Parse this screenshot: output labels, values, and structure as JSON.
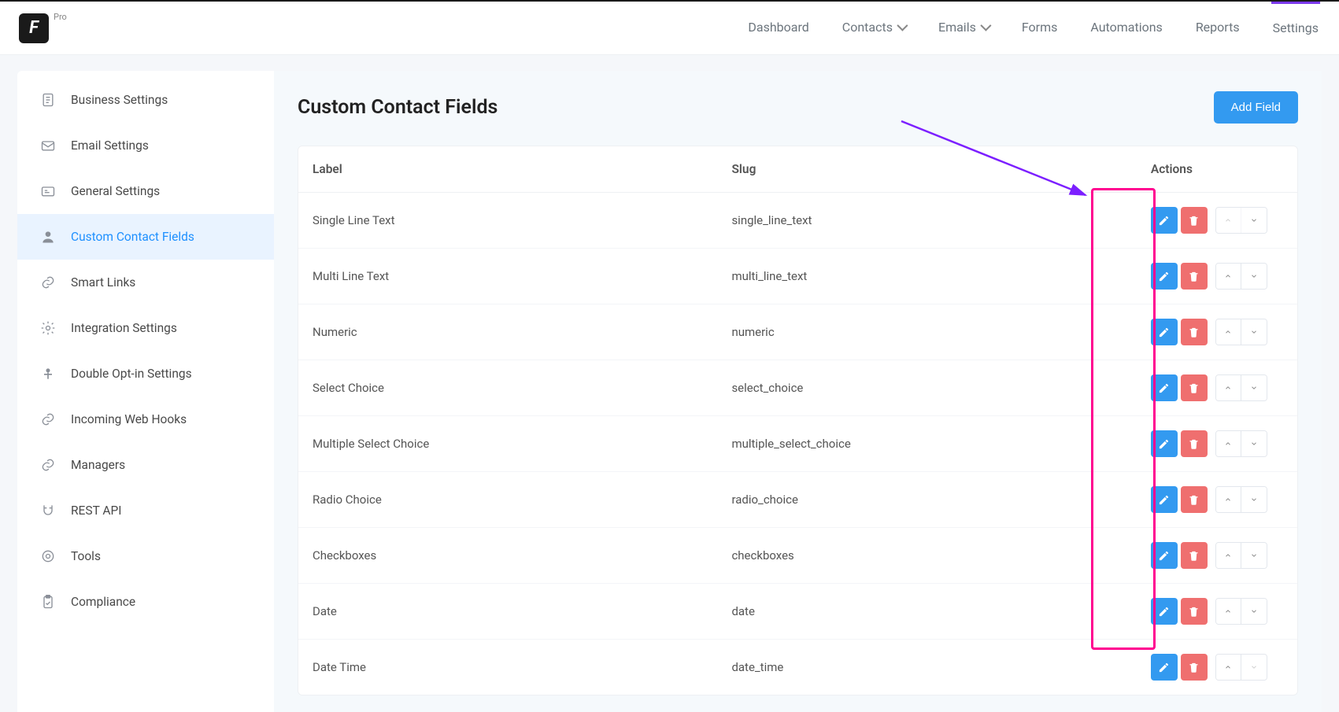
{
  "brand": {
    "pro_label": "Pro"
  },
  "topnav": {
    "items": [
      {
        "label": "Dashboard",
        "dropdown": false
      },
      {
        "label": "Contacts",
        "dropdown": true
      },
      {
        "label": "Emails",
        "dropdown": true
      },
      {
        "label": "Forms",
        "dropdown": false
      },
      {
        "label": "Automations",
        "dropdown": false
      },
      {
        "label": "Reports",
        "dropdown": false
      },
      {
        "label": "Settings",
        "dropdown": false,
        "active": true
      }
    ]
  },
  "sidebar": {
    "items": [
      {
        "label": "Business Settings",
        "icon": "doc"
      },
      {
        "label": "Email Settings",
        "icon": "mail"
      },
      {
        "label": "General Settings",
        "icon": "card"
      },
      {
        "label": "Custom Contact Fields",
        "icon": "user",
        "active": true
      },
      {
        "label": "Smart Links",
        "icon": "link"
      },
      {
        "label": "Integration Settings",
        "icon": "gear"
      },
      {
        "label": "Double Opt-in Settings",
        "icon": "person"
      },
      {
        "label": "Incoming Web Hooks",
        "icon": "link"
      },
      {
        "label": "Managers",
        "icon": "link"
      },
      {
        "label": "REST API",
        "icon": "magnet"
      },
      {
        "label": "Tools",
        "icon": "circle"
      },
      {
        "label": "Compliance",
        "icon": "clipboard"
      }
    ]
  },
  "page": {
    "title": "Custom Contact Fields",
    "add_button": "Add Field"
  },
  "table": {
    "columns": {
      "label": "Label",
      "slug": "Slug",
      "actions": "Actions"
    },
    "rows": [
      {
        "label": "Single Line Text",
        "slug": "single_line_text",
        "up_disabled": true,
        "down_disabled": false
      },
      {
        "label": "Multi Line Text",
        "slug": "multi_line_text",
        "up_disabled": false,
        "down_disabled": false
      },
      {
        "label": "Numeric",
        "slug": "numeric",
        "up_disabled": false,
        "down_disabled": false
      },
      {
        "label": "Select Choice",
        "slug": "select_choice",
        "up_disabled": false,
        "down_disabled": false
      },
      {
        "label": "Multiple Select Choice",
        "slug": "multiple_select_choice",
        "up_disabled": false,
        "down_disabled": false
      },
      {
        "label": "Radio Choice",
        "slug": "radio_choice",
        "up_disabled": false,
        "down_disabled": false
      },
      {
        "label": "Checkboxes",
        "slug": "checkboxes",
        "up_disabled": false,
        "down_disabled": false
      },
      {
        "label": "Date",
        "slug": "date",
        "up_disabled": false,
        "down_disabled": false
      },
      {
        "label": "Date Time",
        "slug": "date_time",
        "up_disabled": false,
        "down_disabled": true
      }
    ]
  }
}
